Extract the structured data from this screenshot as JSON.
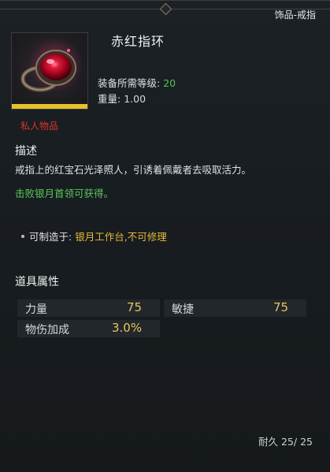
{
  "header": {
    "category": "饰品-戒指"
  },
  "item": {
    "name": "赤红指环",
    "icon": "ruby-ring-icon",
    "rarity_color": "#e6c22a",
    "level_label": "装备所需等级:",
    "level_value": "20",
    "weight_label": "重量:",
    "weight_value": "1.00",
    "private_label": "私人物品"
  },
  "description": {
    "title": "描述",
    "text": "戒指上的红宝石光泽照人，引诱着佩戴者去吸取活力。",
    "obtain": "击败银月首领可获得。"
  },
  "craft": {
    "label": "可制造于:",
    "value": "银月工作台,不可修理"
  },
  "attributes": {
    "title": "道具属性",
    "items": [
      {
        "name": "力量",
        "value": "75"
      },
      {
        "name": "敏捷",
        "value": "75"
      },
      {
        "name": "物伤加成",
        "value": "3.0%"
      }
    ]
  },
  "durability": {
    "label": "耐久",
    "value": "25/ 25"
  },
  "colors": {
    "accent_green": "#51c84a",
    "accent_yellow": "#e3bb34",
    "private_red": "#d8332a"
  }
}
